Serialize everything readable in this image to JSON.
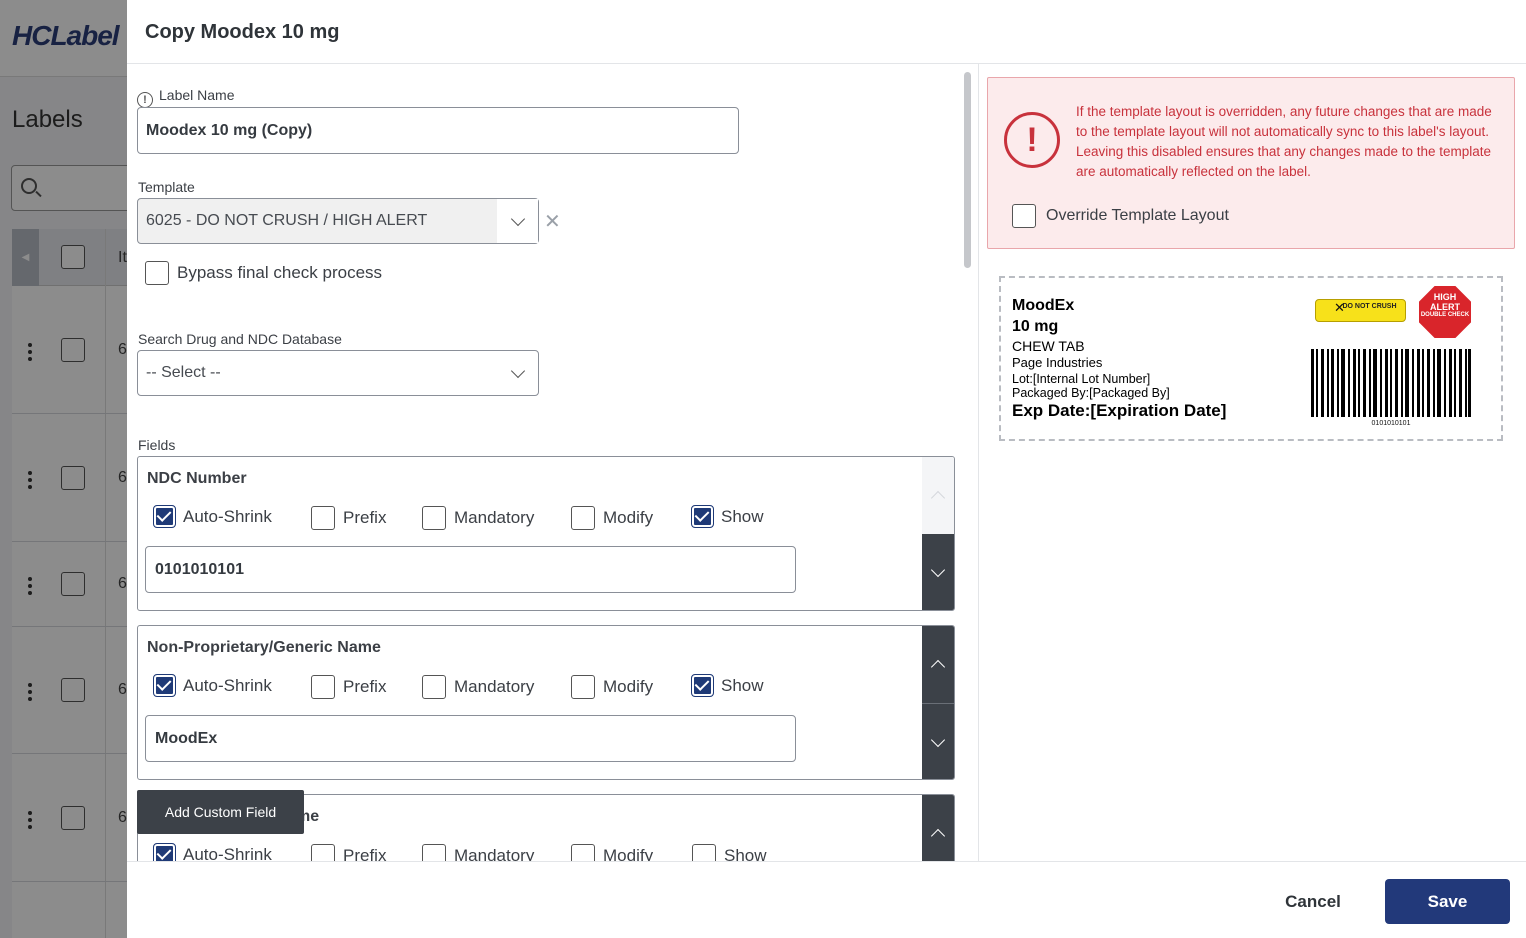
{
  "background": {
    "logo": "HCLabel",
    "page_title": "Labels",
    "table_header_partial": "It",
    "row_cell_partial": "6"
  },
  "modal": {
    "title": "Copy Moodex 10 mg",
    "label_name": {
      "label": "Label Name",
      "value": "Moodex 10 mg (Copy)"
    },
    "template": {
      "label": "Template",
      "value": "6025 - DO NOT CRUSH / HIGH ALERT",
      "clear": "✕"
    },
    "bypass": {
      "label": "Bypass final check process",
      "checked": false
    },
    "search_drug": {
      "label": "Search Drug and NDC Database",
      "value": "-- Select --"
    },
    "fields_label": "Fields",
    "option_labels": {
      "auto_shrink": "Auto-Shrink",
      "prefix": "Prefix",
      "mandatory": "Mandatory",
      "modify": "Modify",
      "show": "Show"
    },
    "fields": [
      {
        "title": "NDC Number",
        "value": "0101010101",
        "auto_shrink": true,
        "prefix": false,
        "mandatory": false,
        "modify": false,
        "show": true
      },
      {
        "title": "Non-Proprietary/Generic Name",
        "value": "MoodEx",
        "auto_shrink": true,
        "prefix": false,
        "mandatory": false,
        "modify": false,
        "show": true
      },
      {
        "title": "me",
        "value": "",
        "auto_shrink": true,
        "prefix": false,
        "mandatory": false,
        "modify": false,
        "show": false
      }
    ],
    "add_custom_field": "Add Custom Field",
    "warning": {
      "icon": "!",
      "text": "If the template layout is overridden, any future changes that are made to the template layout will not automatically sync to this label's layout. Leaving this disabled ensures that any changes made to the template are automatically reflected on the label.",
      "override_label": "Override Template Layout",
      "override_checked": false
    },
    "preview": {
      "brand": "MoodEx",
      "strength": "10 mg",
      "form": "CHEW TAB",
      "manufacturer": "Page Industries",
      "lot": "Lot:[Internal Lot Number]",
      "packaged_by": "Packaged By:[Packaged By]",
      "exp": "Exp Date:[Expiration Date]",
      "do_not_crush": "DO NOT CRUSH",
      "high_alert_1": "HIGH ALERT",
      "high_alert_2": "DOUBLE CHECK",
      "barcode_number": "0101010101"
    },
    "cancel": "Cancel",
    "save": "Save"
  }
}
